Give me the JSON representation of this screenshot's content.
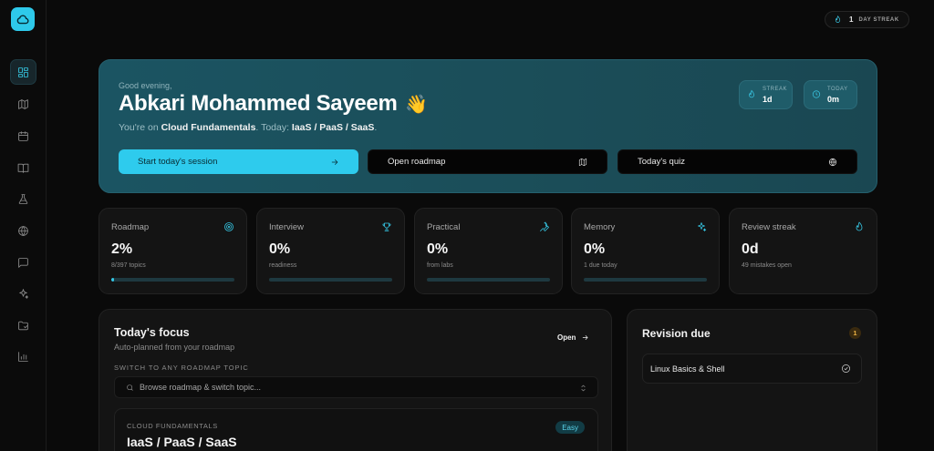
{
  "top_streak": {
    "count": "1",
    "label": "DAY STREAK"
  },
  "sidebar": {
    "items": [
      {
        "icon": "dashboard-icon",
        "active": true
      },
      {
        "icon": "map-icon"
      },
      {
        "icon": "calendar-icon"
      },
      {
        "icon": "book-open-icon"
      },
      {
        "icon": "flask-icon"
      },
      {
        "icon": "globe-icon"
      },
      {
        "icon": "message-icon"
      },
      {
        "icon": "sparkles-icon"
      },
      {
        "icon": "folder-icon"
      },
      {
        "icon": "bar-chart-icon"
      }
    ]
  },
  "hero": {
    "greeting": "Good evening,",
    "name": "Abkari Mohammed Sayeem",
    "wave": "👋",
    "sub_prefix": "You're on ",
    "course": "Cloud Fundamentals",
    "sub_mid": ". Today: ",
    "today_topic": "IaaS / PaaS / SaaS",
    "sub_end": ".",
    "stats": [
      {
        "label": "STREAK",
        "value": "1d",
        "icon": "flame-icon"
      },
      {
        "label": "TODAY",
        "value": "0m",
        "icon": "clock-icon"
      }
    ],
    "buttons": {
      "start": "Start today's session",
      "roadmap": "Open roadmap",
      "quiz": "Today's quiz"
    }
  },
  "cards": [
    {
      "title": "Roadmap",
      "value": "2%",
      "sub": "8/397 topics",
      "icon": "target-icon",
      "progress": 0.02
    },
    {
      "title": "Interview",
      "value": "0%",
      "sub": "readiness",
      "icon": "trophy-icon",
      "progress": 0
    },
    {
      "title": "Practical",
      "value": "0%",
      "sub": "from labs",
      "icon": "wrench-icon",
      "progress": 0
    },
    {
      "title": "Memory",
      "value": "0%",
      "sub": "1 due today",
      "icon": "sparkles-icon",
      "progress": 0
    },
    {
      "title": "Review streak",
      "value": "0d",
      "sub": "49 mistakes open",
      "icon": "flame-icon"
    }
  ],
  "focus": {
    "title": "Today's focus",
    "subtitle": "Auto-planned from your roadmap",
    "open_label": "Open",
    "switch_label": "SWITCH TO ANY ROADMAP TOPIC",
    "search_placeholder": "Browse roadmap & switch topic...",
    "topic": {
      "category": "CLOUD FUNDAMENTALS",
      "name": "IaaS / PaaS / SaaS",
      "difficulty": "Easy"
    }
  },
  "revision": {
    "title": "Revision due",
    "count": "1",
    "items": [
      {
        "label": "Linux Basics & Shell"
      }
    ]
  },
  "colors": {
    "accent": "#2ecbed",
    "hero_bg": "#1b5462",
    "panel_bg": "#141414",
    "badge_amber": "#e9b143"
  }
}
